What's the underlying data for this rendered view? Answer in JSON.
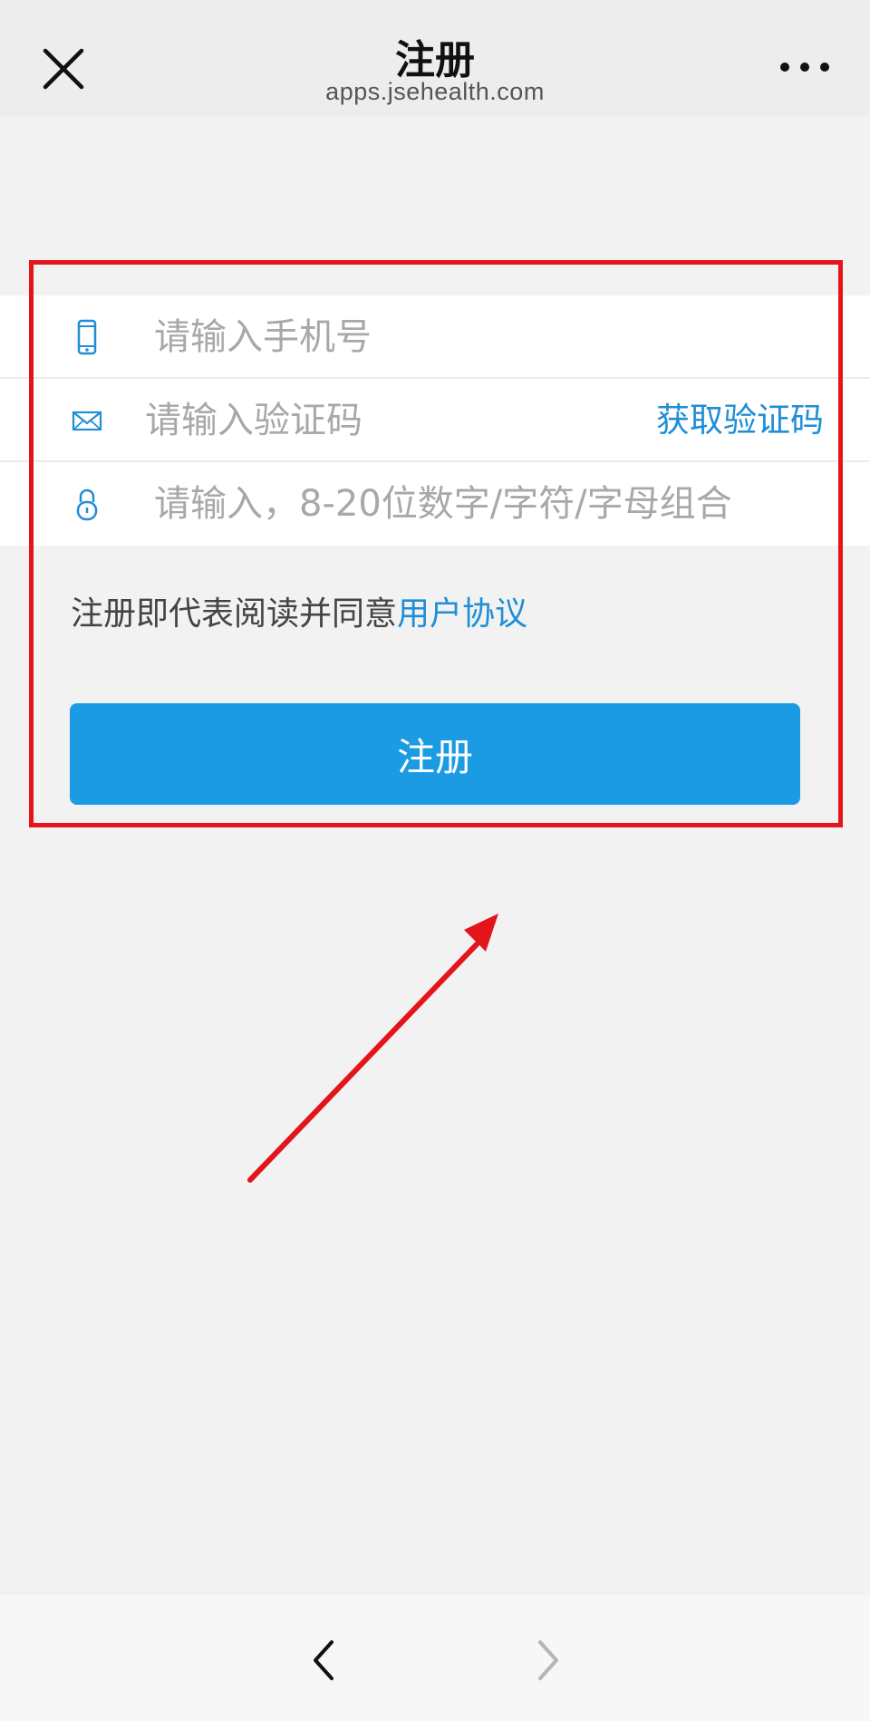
{
  "nav": {
    "title": "注册",
    "url": "apps.jsehealth.com",
    "close_icon": "close-icon",
    "more_icon": "more-icon"
  },
  "form": {
    "phone": {
      "icon": "mobile-phone-icon",
      "placeholder": "请输入手机号",
      "value": ""
    },
    "code": {
      "icon": "envelope-icon",
      "placeholder": "请输入验证码",
      "value": "",
      "get_code_label": "获取验证码"
    },
    "password": {
      "icon": "lock-icon",
      "placeholder": "请输入，8-20位数字/字符/字母组合",
      "value": ""
    }
  },
  "agreement": {
    "text": "注册即代表阅读并同意",
    "link": "用户协议"
  },
  "register_button": {
    "label": "注册"
  },
  "bottom_nav": {
    "back_icon": "chevron-left-icon",
    "forward_icon": "chevron-right-icon"
  },
  "colors": {
    "accent": "#1a9be3",
    "link": "#1f8ed6",
    "annotation": "#e4141b",
    "background": "#f2f2f2"
  }
}
